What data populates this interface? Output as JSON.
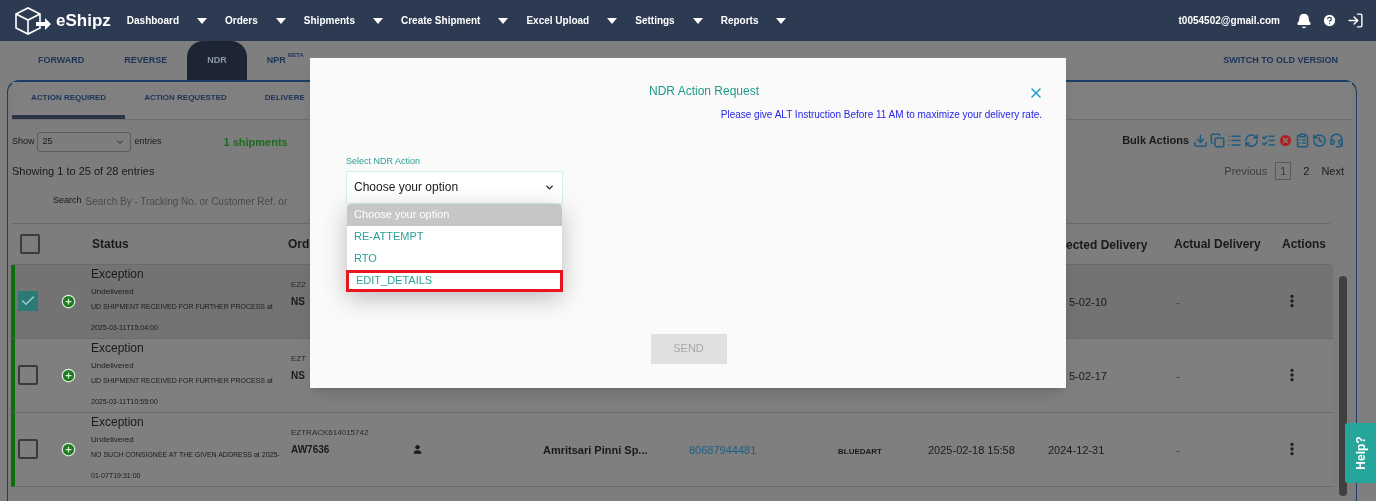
{
  "navbar": {
    "brand": "eShipz",
    "menu": [
      {
        "label": "Dashboard"
      },
      {
        "label": "Orders"
      },
      {
        "label": "Shipments"
      },
      {
        "label": "Create Shipment"
      },
      {
        "label": "Excel Upload"
      },
      {
        "label": "Settings"
      },
      {
        "label": "Reports"
      }
    ],
    "user_email": "t0054502@gmail.com"
  },
  "module_tabs": [
    {
      "label": "FORWARD",
      "selected": false
    },
    {
      "label": "REVERSE",
      "selected": false
    },
    {
      "label": "NDR",
      "selected": true
    },
    {
      "label": "NPR",
      "superscript": "BETA",
      "selected": false
    }
  ],
  "switch_link": "SWITCH TO OLD VERSION",
  "status_tabs": [
    {
      "label": "ACTION REQUIRED",
      "selected": true
    },
    {
      "label": "ACTION REQUESTED",
      "selected": false
    },
    {
      "label": "DELIVERE",
      "selected": false
    }
  ],
  "list_controls": {
    "show_label": "Show",
    "page_size": "25",
    "entries_label": "entries",
    "selection_count": "1 shipments",
    "showing": "Showing 1 to 25 of 28 entries",
    "search_label": "Search",
    "search_placeholder": "Search By - Tracking No. or Customer Ref. or",
    "bulk_actions_label": "Bulk Actions"
  },
  "pagination": {
    "previous": "Previous",
    "pages": [
      {
        "label": "1",
        "selected": true
      },
      {
        "label": "2",
        "selected": false
      }
    ],
    "next": "Next"
  },
  "table": {
    "all_checked": false,
    "columns": [
      "Status",
      "Ord",
      "ected Delivery",
      "Actual Delivery",
      "Actions"
    ],
    "rows": [
      {
        "checked": true,
        "status": "Exception",
        "substatus": "Undelivered",
        "remark": "UD SHIPMENT RECEIVED FOR FURTHER PROCESS at 2025-03-11T15:04:00",
        "order_ref": "EZ2",
        "order_no": "NS",
        "expected_delivery": "5-02-10",
        "actual_delivery": "-"
      },
      {
        "checked": false,
        "status": "Exception",
        "substatus": "Undelivered",
        "remark": "UD SHIPMENT RECEIVED FOR FURTHER PROCESS at 2025-03-11T10:55:00",
        "order_ref": "EZT",
        "order_no": "NS",
        "expected_delivery": "5-02-17",
        "actual_delivery": "-"
      },
      {
        "checked": false,
        "status": "Exception",
        "substatus": "Undelivered",
        "remark": "NO SUCH CONSIGNEE AT THE GIVEN ADDRESS at 2025-01-07T19:31:00",
        "order_ref": "EZTRACK614015742",
        "order_no": "AW7636",
        "consignee": "Amritsari Pinni Sp...",
        "phone": "80687944481",
        "courier": "BLUEDART",
        "date": "2025-02-18 15:58",
        "expected_delivery": "2024-12-31",
        "actual_delivery": "-"
      }
    ]
  },
  "modal": {
    "title": "NDR Action Request",
    "notice": "Please give ALT Instruction Before 11 AM to maximize your delivery rate.",
    "field_label": "Select NDR Action",
    "select_value": "Choose your option",
    "options": [
      {
        "label": "Choose your option",
        "selected": true,
        "highlighted": false
      },
      {
        "label": "RE-ATTEMPT",
        "selected": false,
        "highlighted": false
      },
      {
        "label": "RTO",
        "selected": false,
        "highlighted": false
      },
      {
        "label": "EDIT_DETAILS",
        "selected": false,
        "highlighted": true
      }
    ],
    "send_button": {
      "label": "SEND",
      "disabled": true
    }
  },
  "help_tab": "Help?"
}
